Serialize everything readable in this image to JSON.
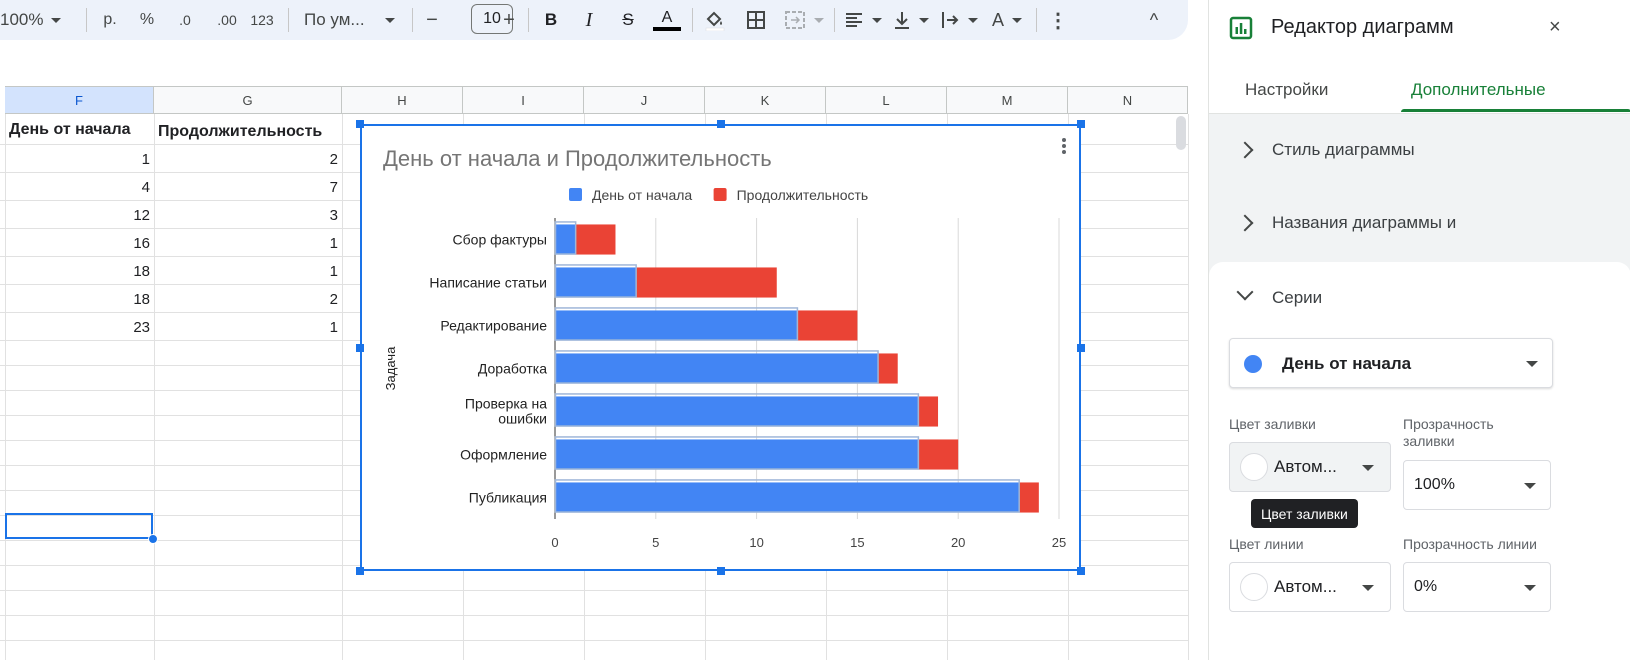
{
  "toolbar": {
    "zoom": "100%",
    "currency": "р.",
    "percent": "%",
    "decrease_decimals": ".0",
    "increase_decimals": ".00",
    "more_formats": "123",
    "font": "По ум...",
    "minus": "−",
    "font_size": "10",
    "plus": "+",
    "bold": "B",
    "italic": "I",
    "strike": "S",
    "text_color": "A",
    "text_color_value": "#000000",
    "text_rotation": "A",
    "more": "⋮",
    "collapse": "^"
  },
  "sheet": {
    "columns": [
      "F",
      "G",
      "H",
      "I",
      "J",
      "K",
      "L",
      "M",
      "N"
    ],
    "selected_column": "F",
    "header_row": [
      "День от начала",
      "Продолжительность"
    ],
    "rows": [
      [
        "1",
        "2"
      ],
      [
        "4",
        "7"
      ],
      [
        "12",
        "3"
      ],
      [
        "16",
        "1"
      ],
      [
        "18",
        "1"
      ],
      [
        "18",
        "2"
      ],
      [
        "23",
        "1"
      ]
    ]
  },
  "chart_data": {
    "type": "bar",
    "orientation": "horizontal",
    "stacked": true,
    "title": "День от начала и Продолжительность",
    "ylabel": "Задача",
    "xlabel": "",
    "categories": [
      "Сбор фактуры",
      "Написание статьи",
      "Редактирование",
      "Доработка",
      "Проверка на ошибки",
      "Оформление",
      "Публикация"
    ],
    "series": [
      {
        "name": "День от начала",
        "color": "#4285f4",
        "values": [
          1,
          4,
          12,
          16,
          18,
          18,
          23
        ]
      },
      {
        "name": "Продолжительность",
        "color": "#ea4335",
        "values": [
          2,
          7,
          3,
          1,
          1,
          2,
          1
        ]
      }
    ],
    "xlim": [
      0,
      25
    ],
    "xticks": [
      0,
      5,
      10,
      15,
      20,
      25
    ],
    "legend_position": "top",
    "grid": true
  },
  "panel": {
    "title": "Редактор диаграмм",
    "close": "×",
    "tabs": [
      "Настройки",
      "Дополнительные"
    ],
    "active_tab": "Дополнительные",
    "sections": {
      "chart_style": "Стиль диаграммы",
      "chart_titles": "Названия диаграммы и",
      "series": "Серии"
    },
    "series_select": "День от начала",
    "fill_color_label": "Цвет заливки",
    "fill_color_value": "Автом...",
    "fill_opacity_label": "Прозрачность заливки",
    "fill_opacity_value": "100%",
    "line_color_label": "Цвет линии",
    "line_color_value": "Автом...",
    "line_opacity_label": "Прозрачность линии",
    "line_opacity_value": "0%",
    "tooltip": "Цвет заливки",
    "accent_color": "#188038"
  }
}
